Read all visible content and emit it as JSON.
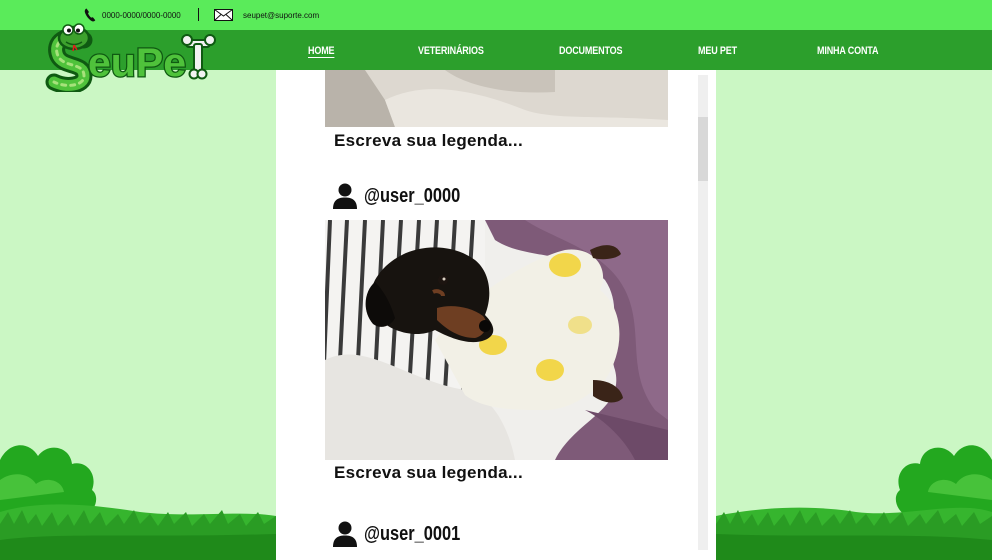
{
  "contact": {
    "phone": "0000-0000/0000-0000",
    "email": "seupet@suporte.com",
    "phone_icon": "phone-icon",
    "email_icon": "envelope-icon"
  },
  "brand": {
    "logo_text": "SeuPeT",
    "logo_icon": "snake-mascot-icon"
  },
  "nav": [
    {
      "label": "HOME",
      "active": true
    },
    {
      "label": "VETERINÁRIOS",
      "active": false
    },
    {
      "label": "DOCUMENTOS",
      "active": false
    },
    {
      "label": "MEU PET",
      "active": false
    },
    {
      "label": "MINHA CONTA",
      "active": false
    }
  ],
  "posts": [
    {
      "caption": "Escreva sua legenda..."
    },
    {
      "user": "@user_0000",
      "caption": "Escreva sua legenda..."
    },
    {
      "user": "@user_0001"
    }
  ],
  "colors": {
    "topbar": "#5aeb5a",
    "navbar": "#2c9f2c",
    "background": "#cbf7c4"
  }
}
